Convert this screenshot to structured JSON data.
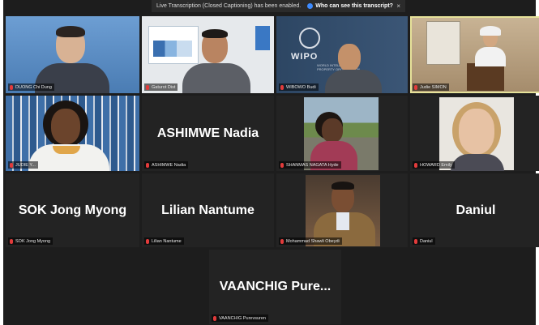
{
  "banner": {
    "message": "Live Transcription (Closed Captioning) has been enabled.",
    "link": "Who can see this transcript?",
    "close": "×"
  },
  "tiles": [
    {
      "name": "DUONG Chi Dung"
    },
    {
      "name": "Gaturot Dist"
    },
    {
      "name": "WIBOWO Budi",
      "logo_text": "WIPO",
      "logo_sub": "WORLD INTELLECTUAL PROPERTY ORGANIZATION"
    },
    {
      "name": "Judie SIMON"
    },
    {
      "name": "JUDIE Y..."
    },
    {
      "name": "ASHIMWE Nadia",
      "display": "ASHIMWE Nadia"
    },
    {
      "name": "SHANMAS NAGATA Hyde"
    },
    {
      "name": "HOWARD Emily"
    },
    {
      "name": "SOK Jong Myong",
      "display": "SOK Jong Myong"
    },
    {
      "name": "Lilian Nantume",
      "display": "Lilian Nantume"
    },
    {
      "name": "Mohammad Shawli Obeydi"
    },
    {
      "name": "Daniul",
      "display": "Daniul"
    },
    {
      "name": "VAANCHIG Purevsuren",
      "display": "VAANCHIG Pure..."
    }
  ],
  "colors": {
    "active_speaker": "#e6e29a",
    "mic_muted": "#e23b3b"
  }
}
